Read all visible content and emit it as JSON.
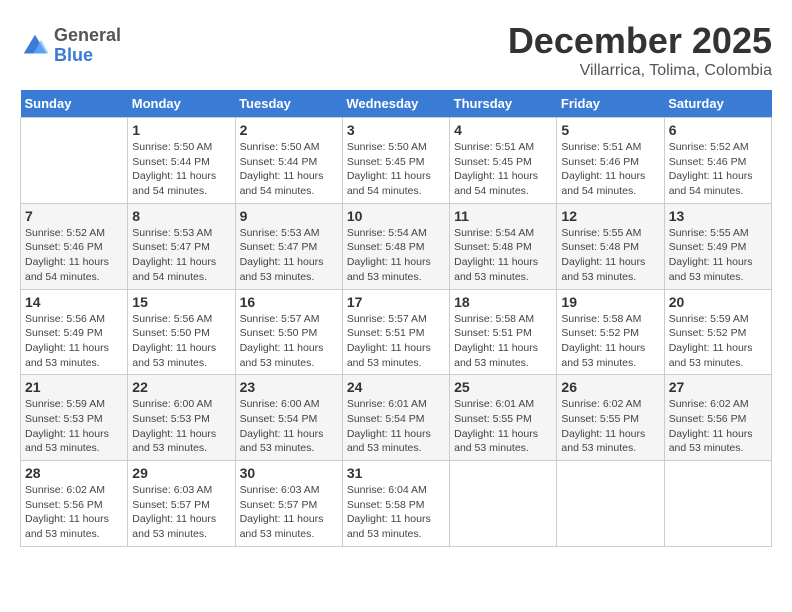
{
  "header": {
    "logo": {
      "general": "General",
      "blue": "Blue"
    },
    "title": "December 2025",
    "subtitle": "Villarrica, Tolima, Colombia"
  },
  "weekdays": [
    "Sunday",
    "Monday",
    "Tuesday",
    "Wednesday",
    "Thursday",
    "Friday",
    "Saturday"
  ],
  "weeks": [
    [
      {
        "day": "",
        "sunrise": "",
        "sunset": "",
        "daylight": ""
      },
      {
        "day": "1",
        "sunrise": "Sunrise: 5:50 AM",
        "sunset": "Sunset: 5:44 PM",
        "daylight": "Daylight: 11 hours and 54 minutes."
      },
      {
        "day": "2",
        "sunrise": "Sunrise: 5:50 AM",
        "sunset": "Sunset: 5:44 PM",
        "daylight": "Daylight: 11 hours and 54 minutes."
      },
      {
        "day": "3",
        "sunrise": "Sunrise: 5:50 AM",
        "sunset": "Sunset: 5:45 PM",
        "daylight": "Daylight: 11 hours and 54 minutes."
      },
      {
        "day": "4",
        "sunrise": "Sunrise: 5:51 AM",
        "sunset": "Sunset: 5:45 PM",
        "daylight": "Daylight: 11 hours and 54 minutes."
      },
      {
        "day": "5",
        "sunrise": "Sunrise: 5:51 AM",
        "sunset": "Sunset: 5:46 PM",
        "daylight": "Daylight: 11 hours and 54 minutes."
      },
      {
        "day": "6",
        "sunrise": "Sunrise: 5:52 AM",
        "sunset": "Sunset: 5:46 PM",
        "daylight": "Daylight: 11 hours and 54 minutes."
      }
    ],
    [
      {
        "day": "7",
        "sunrise": "Sunrise: 5:52 AM",
        "sunset": "Sunset: 5:46 PM",
        "daylight": "Daylight: 11 hours and 54 minutes."
      },
      {
        "day": "8",
        "sunrise": "Sunrise: 5:53 AM",
        "sunset": "Sunset: 5:47 PM",
        "daylight": "Daylight: 11 hours and 54 minutes."
      },
      {
        "day": "9",
        "sunrise": "Sunrise: 5:53 AM",
        "sunset": "Sunset: 5:47 PM",
        "daylight": "Daylight: 11 hours and 53 minutes."
      },
      {
        "day": "10",
        "sunrise": "Sunrise: 5:54 AM",
        "sunset": "Sunset: 5:48 PM",
        "daylight": "Daylight: 11 hours and 53 minutes."
      },
      {
        "day": "11",
        "sunrise": "Sunrise: 5:54 AM",
        "sunset": "Sunset: 5:48 PM",
        "daylight": "Daylight: 11 hours and 53 minutes."
      },
      {
        "day": "12",
        "sunrise": "Sunrise: 5:55 AM",
        "sunset": "Sunset: 5:48 PM",
        "daylight": "Daylight: 11 hours and 53 minutes."
      },
      {
        "day": "13",
        "sunrise": "Sunrise: 5:55 AM",
        "sunset": "Sunset: 5:49 PM",
        "daylight": "Daylight: 11 hours and 53 minutes."
      }
    ],
    [
      {
        "day": "14",
        "sunrise": "Sunrise: 5:56 AM",
        "sunset": "Sunset: 5:49 PM",
        "daylight": "Daylight: 11 hours and 53 minutes."
      },
      {
        "day": "15",
        "sunrise": "Sunrise: 5:56 AM",
        "sunset": "Sunset: 5:50 PM",
        "daylight": "Daylight: 11 hours and 53 minutes."
      },
      {
        "day": "16",
        "sunrise": "Sunrise: 5:57 AM",
        "sunset": "Sunset: 5:50 PM",
        "daylight": "Daylight: 11 hours and 53 minutes."
      },
      {
        "day": "17",
        "sunrise": "Sunrise: 5:57 AM",
        "sunset": "Sunset: 5:51 PM",
        "daylight": "Daylight: 11 hours and 53 minutes."
      },
      {
        "day": "18",
        "sunrise": "Sunrise: 5:58 AM",
        "sunset": "Sunset: 5:51 PM",
        "daylight": "Daylight: 11 hours and 53 minutes."
      },
      {
        "day": "19",
        "sunrise": "Sunrise: 5:58 AM",
        "sunset": "Sunset: 5:52 PM",
        "daylight": "Daylight: 11 hours and 53 minutes."
      },
      {
        "day": "20",
        "sunrise": "Sunrise: 5:59 AM",
        "sunset": "Sunset: 5:52 PM",
        "daylight": "Daylight: 11 hours and 53 minutes."
      }
    ],
    [
      {
        "day": "21",
        "sunrise": "Sunrise: 5:59 AM",
        "sunset": "Sunset: 5:53 PM",
        "daylight": "Daylight: 11 hours and 53 minutes."
      },
      {
        "day": "22",
        "sunrise": "Sunrise: 6:00 AM",
        "sunset": "Sunset: 5:53 PM",
        "daylight": "Daylight: 11 hours and 53 minutes."
      },
      {
        "day": "23",
        "sunrise": "Sunrise: 6:00 AM",
        "sunset": "Sunset: 5:54 PM",
        "daylight": "Daylight: 11 hours and 53 minutes."
      },
      {
        "day": "24",
        "sunrise": "Sunrise: 6:01 AM",
        "sunset": "Sunset: 5:54 PM",
        "daylight": "Daylight: 11 hours and 53 minutes."
      },
      {
        "day": "25",
        "sunrise": "Sunrise: 6:01 AM",
        "sunset": "Sunset: 5:55 PM",
        "daylight": "Daylight: 11 hours and 53 minutes."
      },
      {
        "day": "26",
        "sunrise": "Sunrise: 6:02 AM",
        "sunset": "Sunset: 5:55 PM",
        "daylight": "Daylight: 11 hours and 53 minutes."
      },
      {
        "day": "27",
        "sunrise": "Sunrise: 6:02 AM",
        "sunset": "Sunset: 5:56 PM",
        "daylight": "Daylight: 11 hours and 53 minutes."
      }
    ],
    [
      {
        "day": "28",
        "sunrise": "Sunrise: 6:02 AM",
        "sunset": "Sunset: 5:56 PM",
        "daylight": "Daylight: 11 hours and 53 minutes."
      },
      {
        "day": "29",
        "sunrise": "Sunrise: 6:03 AM",
        "sunset": "Sunset: 5:57 PM",
        "daylight": "Daylight: 11 hours and 53 minutes."
      },
      {
        "day": "30",
        "sunrise": "Sunrise: 6:03 AM",
        "sunset": "Sunset: 5:57 PM",
        "daylight": "Daylight: 11 hours and 53 minutes."
      },
      {
        "day": "31",
        "sunrise": "Sunrise: 6:04 AM",
        "sunset": "Sunset: 5:58 PM",
        "daylight": "Daylight: 11 hours and 53 minutes."
      },
      {
        "day": "",
        "sunrise": "",
        "sunset": "",
        "daylight": ""
      },
      {
        "day": "",
        "sunrise": "",
        "sunset": "",
        "daylight": ""
      },
      {
        "day": "",
        "sunrise": "",
        "sunset": "",
        "daylight": ""
      }
    ]
  ]
}
